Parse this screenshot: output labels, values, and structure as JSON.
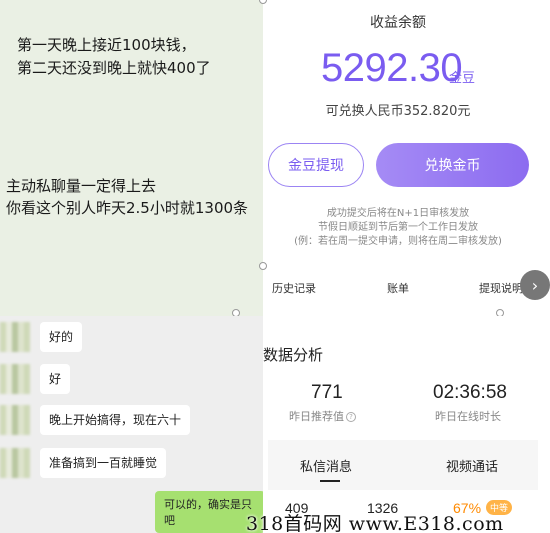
{
  "note": {
    "line1": "第一天晚上接近100块钱，",
    "line2": "第二天还没到晚上就快400了",
    "line3": "主动私聊量一定得上去",
    "line4": "你看这个别人昨天2.5小时就1300条"
  },
  "earnings": {
    "title": "收益余额",
    "amount": "5292.30",
    "unit": "金豆",
    "rmb": "可兑换人民币352.820元",
    "withdraw_label": "金豆提现",
    "exchange_label": "兑换金币",
    "notes": [
      "成功提交后将在N+1日审核发放",
      "节假日顺延到节后第一个工作日发放",
      "(例：若在周一提交申请，则将在周二审核发放)"
    ],
    "links": [
      "历史记录",
      "账单",
      "提现说明"
    ]
  },
  "chat": {
    "messages": [
      "好的",
      "好",
      "晚上开始搞得，现在六十",
      "准备搞到一百就睡觉"
    ],
    "my_message_line1": "可以的，确实是只",
    "my_message_line2": "吧"
  },
  "data": {
    "title": "数据分析",
    "stat1_value": "771",
    "stat1_label": "昨日推荐值",
    "stat2_value": "02:36:58",
    "stat2_label": "昨日在线时长",
    "tab1": "私信消息",
    "tab2": "视频通话",
    "bottom1": "409",
    "bottom2": "1326",
    "bottom3": "67%",
    "badge": "中等"
  },
  "watermark": "318首码网 www.E318.com",
  "colors": {
    "accent": "#7a5cf0",
    "note_bg": "#eaf0e4",
    "chat_bg": "#eeeeee",
    "bubble_green": "#a6e070"
  }
}
